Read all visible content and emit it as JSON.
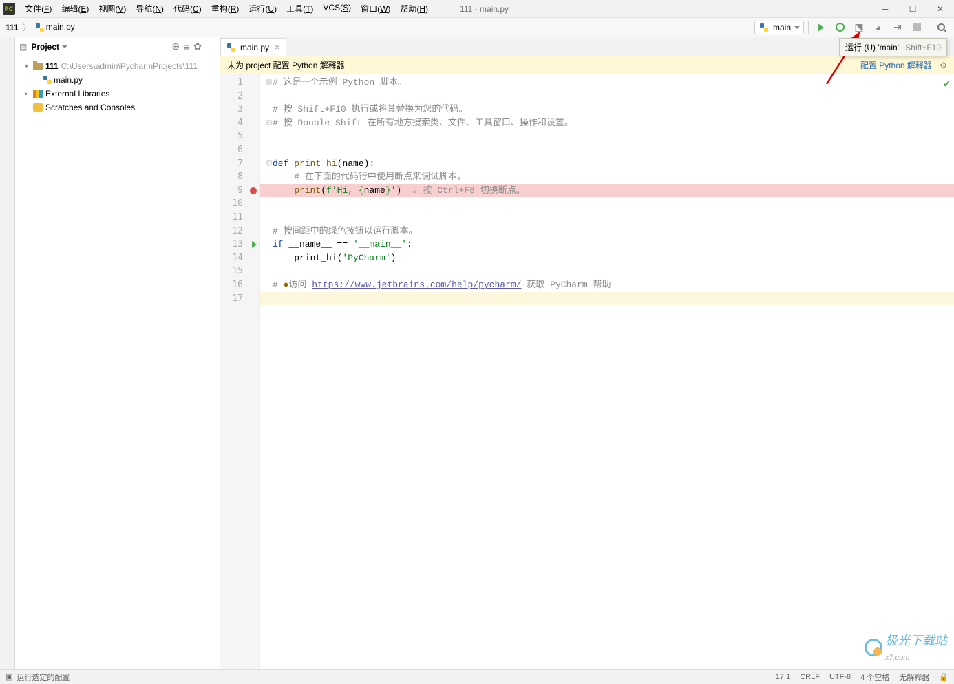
{
  "title": "111 - main.py",
  "menus": [
    "文件(F)",
    "编辑(E)",
    "视图(V)",
    "导航(N)",
    "代码(C)",
    "重构(R)",
    "运行(U)",
    "工具(T)",
    "VCS(S)",
    "窗口(W)",
    "帮助(H)"
  ],
  "breadcrumbs": {
    "project": "111",
    "file": "main.py"
  },
  "run_config": "main",
  "tooltip": {
    "text": "运行 (U) 'main'",
    "shortcut": "Shift+F10"
  },
  "sidebar": {
    "title": "Project",
    "root": {
      "name": "111",
      "path": "C:\\Users\\admin\\PycharmProjects\\111"
    },
    "file": "main.py",
    "ext_lib": "External Libraries",
    "scratch": "Scratches and Consoles"
  },
  "tab": "main.py",
  "warning": {
    "text": "未为 project 配置 Python 解释器",
    "link": "配置 Python 解释器"
  },
  "code_lines": [
    {
      "n": 1,
      "frag": [
        {
          "t": "# 这是一个示例 Python 脚本。",
          "c": "c-cmt"
        }
      ],
      "fold": "⊟"
    },
    {
      "n": 2,
      "frag": []
    },
    {
      "n": 3,
      "frag": [
        {
          "t": "# 按 Shift+F10 执行或将其替换为您的代码。",
          "c": "c-cmt"
        }
      ]
    },
    {
      "n": 4,
      "frag": [
        {
          "t": "# 按 Double Shift 在所有地方搜索类、文件、工具窗口、操作和设置。",
          "c": "c-cmt"
        }
      ],
      "fold": "⊟"
    },
    {
      "n": 5,
      "frag": []
    },
    {
      "n": 6,
      "frag": []
    },
    {
      "n": 7,
      "frag": [
        {
          "t": "def ",
          "c": "c-kw"
        },
        {
          "t": "print_hi",
          "c": "c-fn"
        },
        {
          "t": "(name):",
          "c": ""
        }
      ],
      "fold": "⊟"
    },
    {
      "n": 8,
      "frag": [
        {
          "t": "    ",
          "c": ""
        },
        {
          "t": "# 在下面的代码行中使用断点来调试脚本。",
          "c": "c-cmt"
        }
      ]
    },
    {
      "n": 9,
      "frag": [
        {
          "t": "    ",
          "c": ""
        },
        {
          "t": "print",
          "c": "c-fn"
        },
        {
          "t": "(",
          "c": ""
        },
        {
          "t": "f'Hi, {",
          "c": "c-str"
        },
        {
          "t": "name",
          "c": ""
        },
        {
          "t": "}'",
          "c": "c-str"
        },
        {
          "t": ")  ",
          "c": ""
        },
        {
          "t": "# 按 Ctrl+F8 切换断点。",
          "c": "c-cmt"
        }
      ],
      "bp": true
    },
    {
      "n": 10,
      "frag": []
    },
    {
      "n": 11,
      "frag": []
    },
    {
      "n": 12,
      "frag": [
        {
          "t": "# 按间距中的绿色按钮以运行脚本。",
          "c": "c-cmt"
        }
      ]
    },
    {
      "n": 13,
      "frag": [
        {
          "t": "if ",
          "c": "c-kw"
        },
        {
          "t": "__name__ == ",
          "c": ""
        },
        {
          "t": "'__main__'",
          "c": "c-str"
        },
        {
          "t": ":",
          "c": ""
        }
      ],
      "runmark": true
    },
    {
      "n": 14,
      "frag": [
        {
          "t": "    print_hi(",
          "c": ""
        },
        {
          "t": "'PyCharm'",
          "c": "c-str"
        },
        {
          "t": ")",
          "c": ""
        }
      ]
    },
    {
      "n": 15,
      "frag": []
    },
    {
      "n": 16,
      "frag": [
        {
          "t": "# ",
          "c": "c-cmt"
        },
        {
          "t": "●",
          "c": "c-deco"
        },
        {
          "t": "访问 ",
          "c": "c-cmt"
        },
        {
          "t": "https://www.jetbrains.com/help/pycharm/",
          "c": "c-link"
        },
        {
          "t": " 获取 PyCharm 帮助",
          "c": "c-cmt"
        }
      ]
    },
    {
      "n": 17,
      "frag": [],
      "current": true
    }
  ],
  "status": {
    "left_checkbox": "运行选定的配置",
    "pos": "17:1",
    "eol": "CRLF",
    "enc": "UTF-8",
    "indent": "4 个空格",
    "interp": "无解释器"
  },
  "watermark": {
    "text": "极光下载站",
    "url": "x7.com"
  }
}
